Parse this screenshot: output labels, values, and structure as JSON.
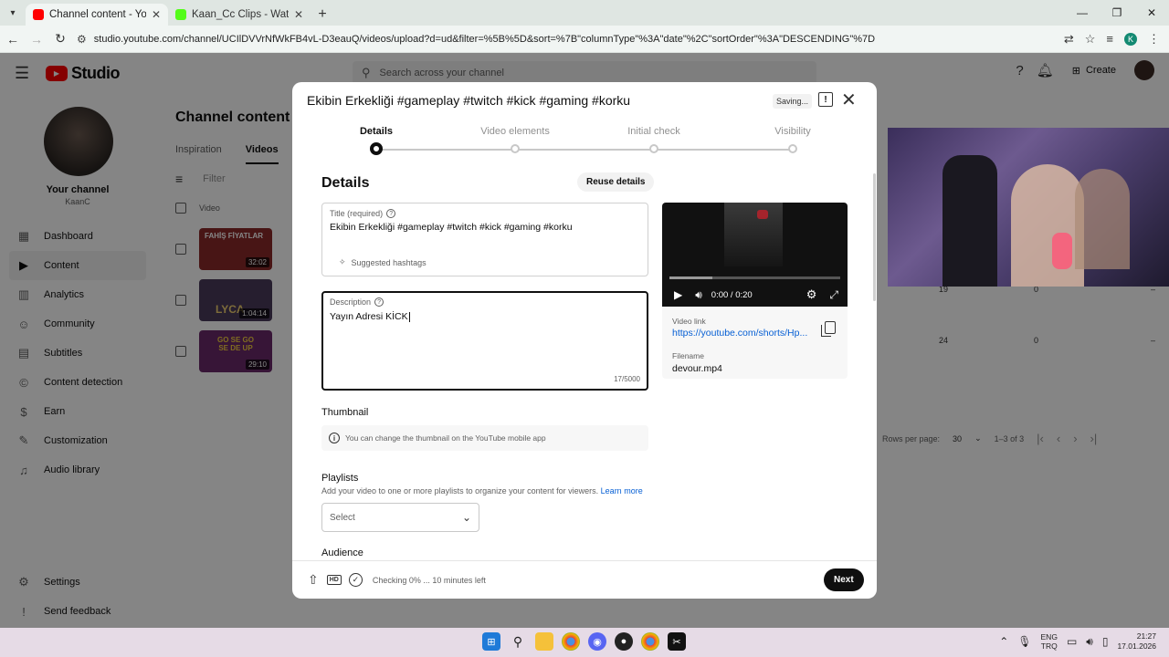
{
  "browser": {
    "tabs": [
      {
        "title": "Channel content - YouTube Studio",
        "active": true
      },
      {
        "title": "Kaan_Cc Clips - Watch Live on Kick",
        "active": false
      }
    ],
    "url": "studio.youtube.com/channel/UCIlDVVrNfWkFB4vL-D3eauQ/videos/upload?d=ud&filter=%5B%5D&sort=%7B\"columnType\"%3A\"date\"%2C\"sortOrder\"%3A\"DESCENDING\"%7D",
    "profile_initial": "K"
  },
  "studio": {
    "logo_text": "Studio",
    "search_placeholder": "Search across your channel",
    "create_label": "Create",
    "channel_label": "Your channel",
    "channel_handle": "KaanC",
    "nav": [
      "Dashboard",
      "Content",
      "Analytics",
      "Community",
      "Subtitles",
      "Content detection",
      "Earn",
      "Customization",
      "Audio library"
    ],
    "nav_bottom": [
      "Settings",
      "Send feedback"
    ],
    "page_title": "Channel content",
    "tabs": [
      "Inspiration",
      "Videos"
    ],
    "filter_placeholder": "Filter",
    "col_video": "Video",
    "videos": [
      {
        "duration": "32:02",
        "thumb_color": "#8a2a2a",
        "thumb_text": "FAHİŞ FİYATLAR"
      },
      {
        "duration": "1:04:14",
        "thumb_color": "#4a3a5a",
        "thumb_text": "LYCA"
      },
      {
        "duration": "29:10",
        "thumb_color": "#6a2a6a",
        "thumb_text": "GO SE GO SE DE UP"
      }
    ],
    "row_values": [
      [
        "19",
        "0",
        "–"
      ],
      [
        "24",
        "0",
        "–"
      ]
    ],
    "pager": {
      "rows_label": "Rows per page:",
      "rows_value": "30",
      "range": "1–3 of 3"
    }
  },
  "modal": {
    "title": "Ekibin Erkekliği #gameplay #twitch #kick #gaming #korku",
    "saving": "Saving...",
    "steps": [
      "Details",
      "Video elements",
      "Initial check",
      "Visibility"
    ],
    "active_step": 0,
    "section_heading": "Details",
    "reuse_label": "Reuse details",
    "title_label": "Title (required)",
    "title_value": "Ekibin Erkekliği  #gameplay #twitch #kick #gaming #korku",
    "suggested_hashtags": "Suggested hashtags",
    "desc_label": "Description",
    "desc_value": "Yayın Adresi KİCK",
    "desc_counter": "17/5000",
    "thumbnail_heading": "Thumbnail",
    "thumbnail_note": "You can change the thumbnail on the YouTube mobile app",
    "playlists_heading": "Playlists",
    "playlists_hint": "Add your video to one or more playlists to organize your content for viewers.",
    "learn_more": "Learn more",
    "playlist_select": "Select",
    "audience_heading": "Audience",
    "video": {
      "time": "0:00 / 0:20",
      "progress_fraction": 0.0,
      "buffer_fraction": 0.25,
      "link_label": "Video link",
      "link": "https://youtube.com/shorts/Hp...",
      "filename_label": "Filename",
      "filename": "devour.mp4"
    },
    "checking_status": "Checking 0% ... 10 minutes left",
    "next_label": "Next"
  },
  "taskbar": {
    "lang_top": "ENG",
    "lang_bottom": "TRQ",
    "time": "21:27",
    "date": "17.01.2026"
  },
  "colors": {
    "youtube_red": "#ff0000",
    "link_blue": "#065fd4",
    "kick_green": "#53fc18",
    "primary_button": "#0f0f0f"
  }
}
